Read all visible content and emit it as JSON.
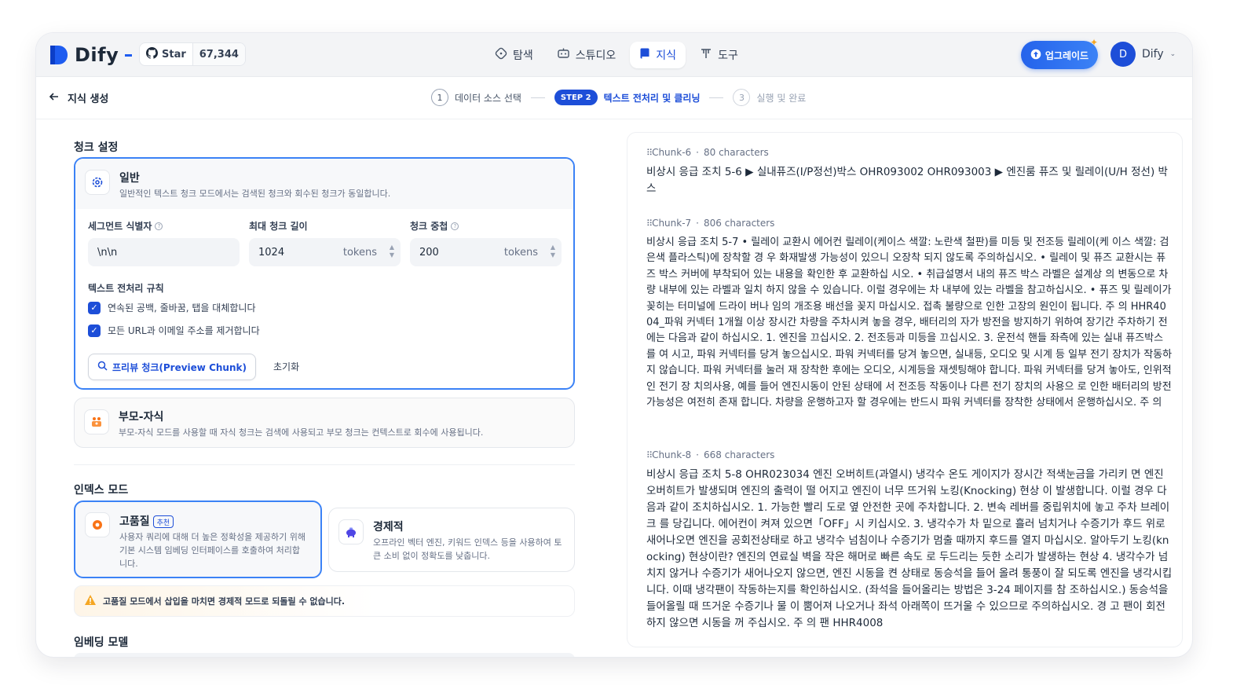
{
  "header": {
    "logo_text": "Dify",
    "github": {
      "star_label": "Star",
      "star_count": "67,344"
    },
    "nav": [
      {
        "label": "탐색",
        "icon": "compass-icon"
      },
      {
        "label": "스튜디오",
        "icon": "robot-icon"
      },
      {
        "label": "지식",
        "icon": "book-icon",
        "active": true
      },
      {
        "label": "도구",
        "icon": "tools-icon"
      }
    ],
    "upgrade_label": "업그레이드",
    "user": {
      "initial": "D",
      "name": "Dify"
    }
  },
  "subheader": {
    "back_label": "지식 생성",
    "steps": [
      {
        "num": "1",
        "label": "데이터 소스 선택"
      },
      {
        "badge": "STEP 2",
        "label": "텍스트 전처리 및 클리닝"
      },
      {
        "num": "3",
        "label": "실행 및 완료"
      }
    ]
  },
  "chunk_settings": {
    "title": "청크 설정",
    "general": {
      "title": "일반",
      "description": "일반적인 텍스트 청크 모드에서는 검색된 청크와 회수된 청크가 동일합니다.",
      "segment_label": "세그먼트 식별자",
      "segment_value": "\\n\\n",
      "max_len_label": "최대 청크 길이",
      "max_len_value": "1024",
      "overlap_label": "청크 중첩",
      "overlap_value": "200",
      "unit": "tokens",
      "rules_label": "텍스트 전처리 규칙",
      "rule1": "연속된 공백, 줄바꿈, 탭을 대체합니다",
      "rule2": "모든 URL과 이메일 주소를 제거합니다",
      "preview_button": "프리뷰 청크(Preview Chunk)",
      "reset_button": "초기화"
    },
    "parent_child": {
      "title": "부모-자식",
      "description": "부모-자식 모드를 사용할 때 자식 청크는 검색에 사용되고 부모 청크는 컨텍스트로 회수에 사용됩니다."
    }
  },
  "index_mode": {
    "title": "인덱스 모드",
    "high_quality": {
      "title": "고품질",
      "badge": "추천",
      "description": "사용자 쿼리에 대해 더 높은 정확성을 제공하기 위해 기본 시스템 임베딩 인터페이스를 호출하여 처리합니다."
    },
    "economy": {
      "title": "경제적",
      "description": "오프라인 벡터 엔진, 키워드 인덱스 등을 사용하여 토큰 소비 없이 정확도를 낮춥니다."
    },
    "warning": "고품질 모드에서 삽입을 마치면 경제적 모드로 되돌릴 수 없습니다."
  },
  "embedding": {
    "title": "임베딩 모델"
  },
  "preview": {
    "chunks": [
      {
        "id": "Chunk-6",
        "chars": "80 characters",
        "text": "비상시 응급 조치 5-6 ▶ 실내퓨즈(I/P정선)박스 OHR093002 OHR093003 ▶ 엔진룸 퓨즈 및 릴레이(U/H 정선) 박스"
      },
      {
        "id": "Chunk-7",
        "chars": "806 characters",
        "text": "비상시 응급 조치 5-7 • 릴레이 교환시 에어컨 릴레이(케이스 색깔: 노란색 철판)를 미등 및 전조등 릴레이(케 이스 색깔: 검은색 플라스틱)에 장착할 경 우 화재발생 가능성이 있으니 오장착 되지 않도록 주의하십시오. • 릴레이 및 퓨즈 교환시는 퓨즈 박스 커버에 부착되어 있는 내용을 확인한 후 교환하십 시오. • 취급설명서 내의 퓨즈 박스 라벨은 설계상 의 변동으로 차량 내부에 있는 라벨과 일치 하지 않을 수 있습니다. 이럴 경우에는 차 내부에 있는 라벨을 참고하십시오. • 퓨즈 및 릴레이가 꽂히는 터미널에 드라이 버나 임의 개조용 배선을 꽂지 마십시오. 접촉 불량으로 인한 고장의 원인이 됩니다. 주 의 HHR4004_파워 커넥터 1개월 이상 장시간 차량을 주차시켜 놓을 경우, 배터리의 자가 방전을 방지하기 위하여 장기간 주차하기 전에는 다음과 같이 하십시오. 1. 엔진을 끄십시오. 2. 전조등과 미등을 끄십시오. 3. 운전석 핸들 좌측에 있는 실내 퓨즈박스를 여 시고, 파워 커넥터를 당겨 놓으십시오. 파워 커넥터를 당겨 놓으면, 실내등, 오디오 및 시계 등 일부 전기 장치가 작동하지 않습니다. 파워 커넥터를 눌러 재 장착한 후에는 오디오, 시계등을 재셋팅해야 합니다. 파워 커넥터를 당겨 놓아도, 인위적인 전기 장 치의사용, 예를 들어 엔진시동이 안된 상태에 서 전조등 작동이나 다른 전기 장치의 사용으 로 인한 배터리의 방전 가능성은 여전히 존재 합니다. 차량을 운행하고자 할 경우에는 반드시 파워 커넥터를 장착한 상태에서 운행하십시오. 주 의"
      },
      {
        "id": "Chunk-8",
        "chars": "668 characters",
        "text": "비상시 응급 조치 5-8 OHR023034 엔진 오버히트(과열시) 냉각수 온도 게이지가 장시간 적색눈금을 가리키 면 엔진 오버히트가 발생되며 엔진의 출력이 떨 어지고 엔진이 너무 뜨거워 노킹(Knocking) 현상 이 발생합니다. 이럴 경우 다음과 같이 조치하십시오. 1. 가능한 빨리 도로 옆 안전한 곳에 주차합니다. 2. 변속 레버를 중립위치에 놓고 주차 브레이크 를 당깁니다. 에어컨이 켜져 있으면「OFF」시 키십시오. 3. 냉각수가 차 밑으로 흘러 넘치거나 수증기가 후드 위로 새어나오면 엔진을 공회전상태로 하고 냉각수 넘침이나 수증기가 멈출 때까지 후드를 열지 마십시오. 알아두기 노킹(knocking) 현상이란? 엔진의 연료실 벽을 작은 해머로 빠른 속도 로 두드리는 듯한 소리가 발생하는 현상 4. 냉각수가 넘치지 않거나 수증기가 새어나오지 않으면, 엔진 시동을 켠 상태로 동승석을 들어 올려 통풍이 잘 되도록 엔진을 냉각시킵니다. 이때 냉각팬이 작동하는지를 확인하십시오. (좌석을 들어올리는 방법은 3-24 페이지를 참 조하십시오.) 동승석을 들어올릴 때 뜨거운 수증기나 물 이 뿜어져 나오거나 좌석 아래쪽이 뜨거울 수 있으므로 주의하십시오. 경 고 팬이 회전하지 않으면 시동을 꺼 주십시오. 주 의 팬 HHR4008"
      }
    ]
  },
  "colors": {
    "accent": "#1d4ed8",
    "border_active": "#3b82f6",
    "warning": "#f5a623"
  }
}
